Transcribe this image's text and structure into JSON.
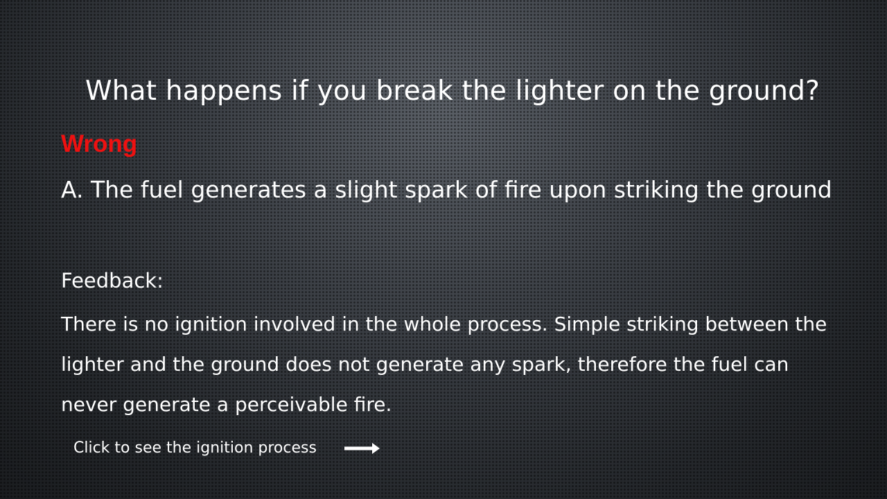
{
  "question": {
    "text": "What happens if you break the lighter on the ground?"
  },
  "result": {
    "label": "Wrong",
    "color": "#ee1111"
  },
  "answer": {
    "text": "A. The fuel generates a slight spark of fire upon striking the ground"
  },
  "feedback": {
    "label": "Feedback:",
    "lines": [
      "There is no ignition involved in the whole process. Simple striking between the",
      "lighter and the ground does not generate any spark, therefore the fuel can",
      "never generate a perceivable fire."
    ]
  },
  "cta": {
    "label": "Click to see the ignition process",
    "icon": "right-arrow-icon"
  }
}
